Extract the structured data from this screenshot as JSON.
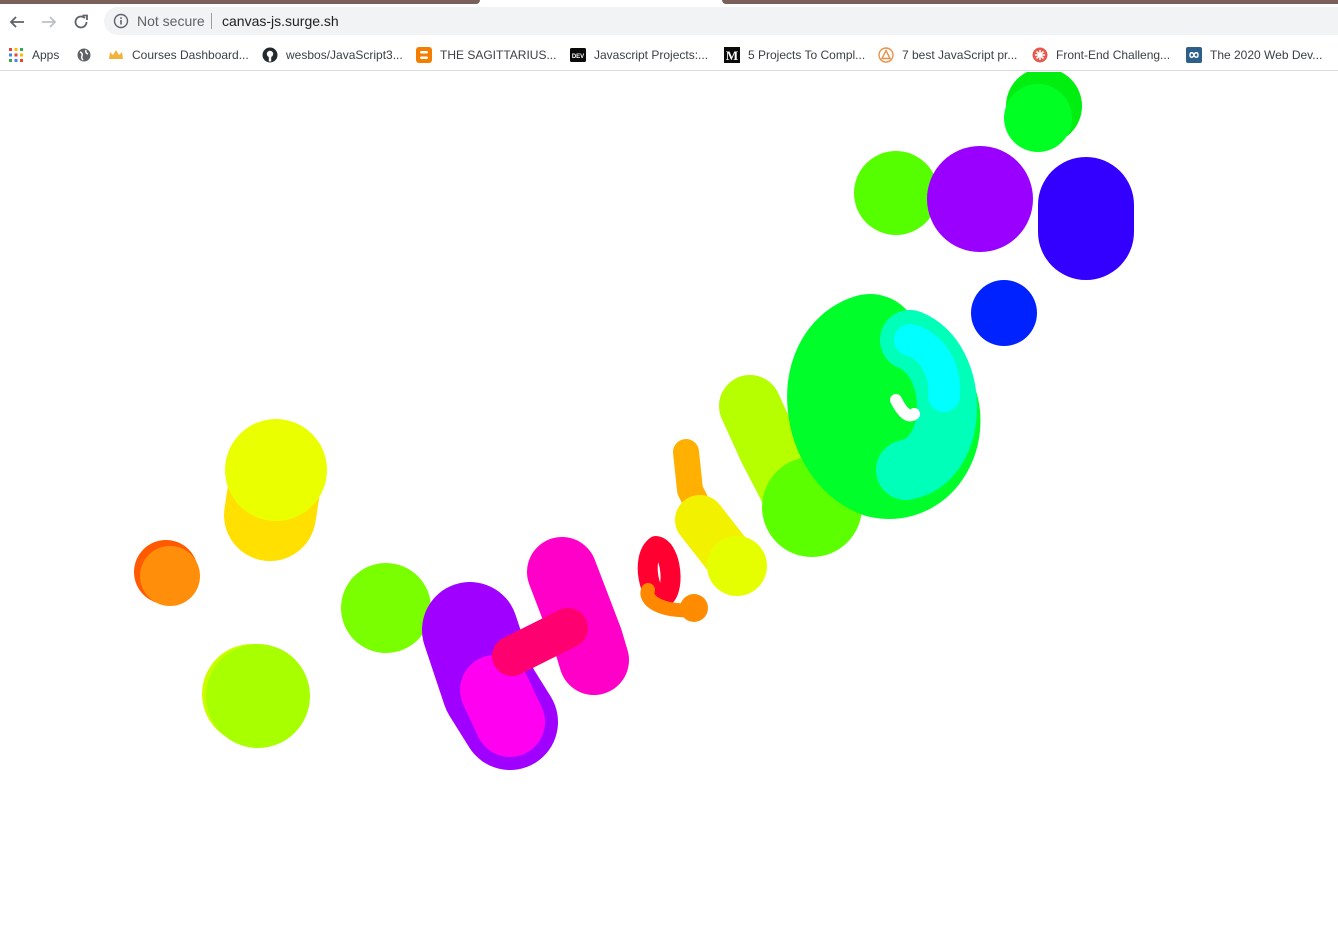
{
  "browser": {
    "security_label": "Not secure",
    "url": "canvas-js.surge.sh"
  },
  "bookmarks": [
    {
      "label": "Apps",
      "icon": "apps-grid-icon"
    },
    {
      "label": "",
      "icon": "globe-icon"
    },
    {
      "label": "Courses Dashboard...",
      "icon": "crown-icon"
    },
    {
      "label": "wesbos/JavaScript3...",
      "icon": "github-icon"
    },
    {
      "label": "THE SAGITTARIUS...",
      "icon": "blogger-icon"
    },
    {
      "label": "Javascript Projects:...",
      "icon": "dev-icon"
    },
    {
      "label": "5 Projects To Compl...",
      "icon": "medium-icon"
    },
    {
      "label": "7 best JavaScript pr...",
      "icon": "triangle-logo-icon"
    },
    {
      "label": "Front-End Challeng...",
      "icon": "flower-icon"
    },
    {
      "label": "The 2020 Web Dev...",
      "icon": "infinity-icon"
    }
  ],
  "drawing": {
    "description_colors": [
      "#ff8c00",
      "#ffff00",
      "#7fff00",
      "#ff00ff",
      "#9900ff",
      "#ff0066",
      "#00ff00",
      "#00ffff",
      "#0000ff"
    ]
  }
}
